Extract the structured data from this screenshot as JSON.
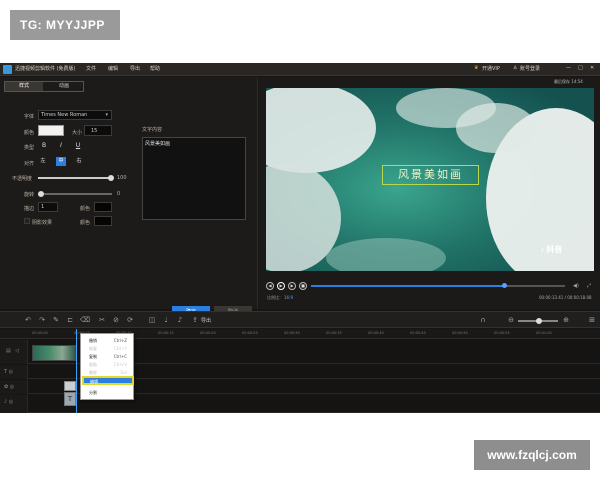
{
  "watermark_top": "TG: MYYJJPP",
  "watermark_bottom": "www.fzqlcj.com",
  "app": {
    "title": "迅捷视频剪辑软件 (免费版)",
    "menus": [
      "文件",
      "编辑",
      "导出",
      "帮助"
    ],
    "vip": "开通VIP",
    "account": "账号登录",
    "window_buttons": [
      "—",
      "□",
      "✕"
    ]
  },
  "text_panel": {
    "tabs": [
      "样式",
      "动画"
    ],
    "font_label": "字体",
    "font_value": "Times New Roman",
    "color_label": "颜色",
    "size_label": "大小",
    "size_value": "15",
    "type_label": "类型",
    "type_buttons": [
      "B",
      "I",
      "U"
    ],
    "align_label": "对齐",
    "align_buttons": [
      "左",
      "中",
      "右"
    ],
    "opacity_label": "不透明度",
    "opacity_value": "100",
    "rotate_label": "旋转",
    "rotate_value": "0",
    "stroke_label": "描边",
    "stroke_value": "1",
    "stroke_color_label": "颜色",
    "shadow_label": "阴影效果",
    "shadow_color_label": "颜色",
    "content_label": "文字内容",
    "content_value": "风景美如画",
    "ok_label": "确定",
    "cancel_label": "取消"
  },
  "preview": {
    "top_time": "最后保存 14:54",
    "video_title": "风景美如画",
    "tiktok": "抖音",
    "ratio_label": "比例比：",
    "ratio_value": "16:9",
    "time": "00:00:13.41 / 00:00:18.08",
    "progress": 0.76
  },
  "timeline": {
    "export_label": "导出",
    "ruler": [
      "00:00:00",
      "00:00:05",
      "00:00:10",
      "00:00:15",
      "00:00:20",
      "00:00:25",
      "00:00:30",
      "00:00:35",
      "00:00:40",
      "00:00:45",
      "00:00:50",
      "00:00:55",
      "00:01:00"
    ]
  },
  "context_menu": {
    "items": [
      {
        "label": "撤销",
        "shortcut": "Ctrl+Z",
        "enabled": true
      },
      {
        "label": "恢复",
        "shortcut": "Ctrl+Y",
        "enabled": false
      },
      {
        "label": "复制",
        "shortcut": "Ctrl+C",
        "enabled": true
      },
      {
        "label": "粘贴",
        "shortcut": "Ctrl+V",
        "enabled": false
      },
      {
        "label": "删除",
        "shortcut": "Del",
        "enabled": false
      },
      {
        "label": "编辑",
        "shortcut": "",
        "enabled": true
      },
      {
        "label": "分割",
        "shortcut": "",
        "enabled": true
      }
    ]
  },
  "colors": {
    "accent": "#2b7fe0",
    "highlight": "#e6d62a",
    "bg": "#161515"
  }
}
